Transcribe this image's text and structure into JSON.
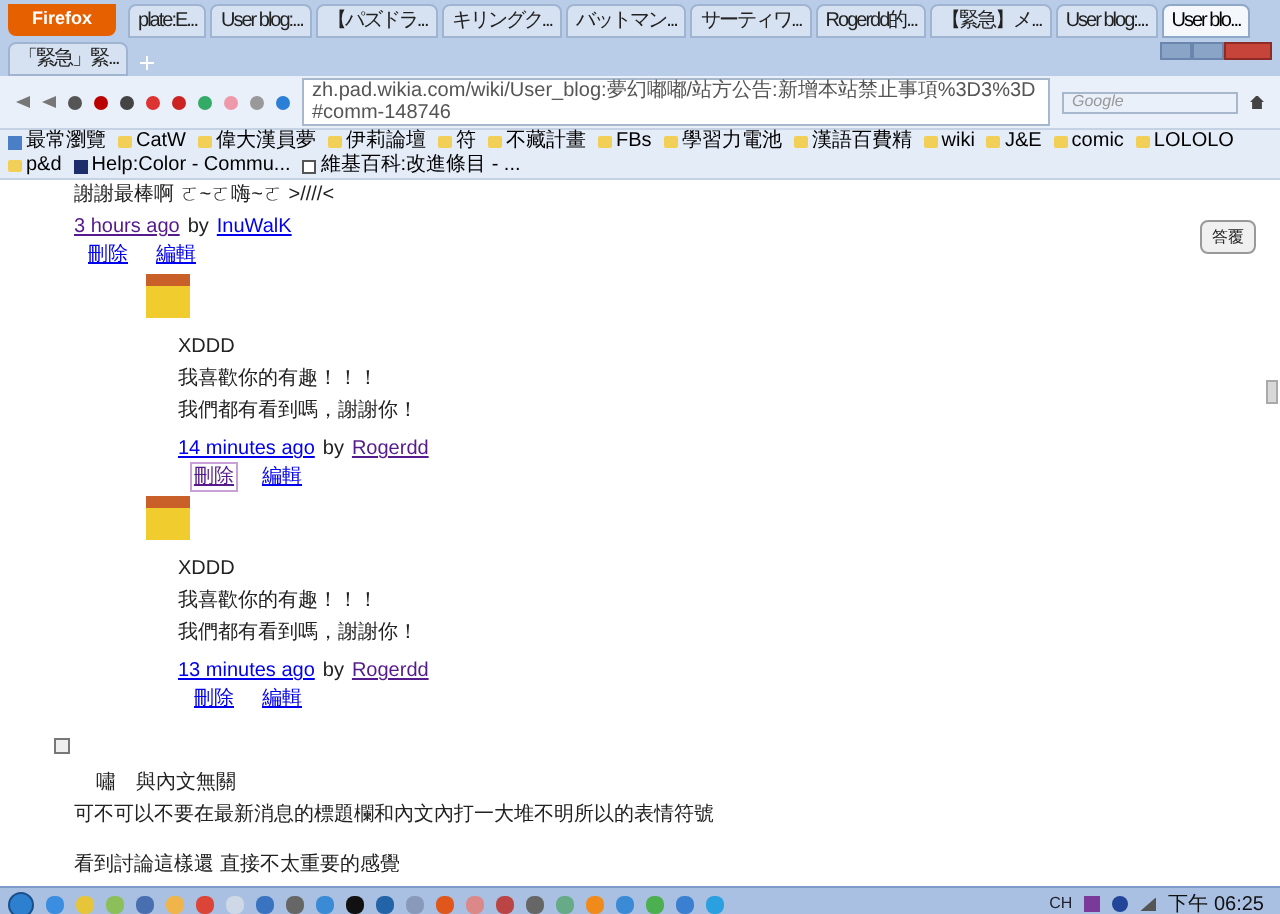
{
  "browser": {
    "menu_button": "Firefox",
    "tabs": [
      {
        "title": "plate:E...",
        "selected": false
      },
      {
        "title": "User blog:...",
        "selected": false
      },
      {
        "title": "【パズドラ...",
        "selected": false
      },
      {
        "title": "キリングク...",
        "selected": false
      },
      {
        "title": "バットマン...",
        "selected": false
      },
      {
        "title": "サーティワ...",
        "selected": false
      },
      {
        "title": "Rogerdd的...",
        "selected": false
      },
      {
        "title": "【緊急】メ...",
        "selected": false
      },
      {
        "title": "User blog:...",
        "selected": false
      },
      {
        "title": "User blo...",
        "selected": true
      },
      {
        "title": "「緊急」緊...",
        "selected": false
      }
    ],
    "url": "zh.pad.wikia.com/wiki/User_blog:夢幻嘟嘟/站方公告:新增本站禁止事項%3D3%3D#comm-148746",
    "search": {
      "placeholder": "Google"
    },
    "bookmarks": [
      {
        "label": "最常瀏覽",
        "kind": "special"
      },
      {
        "label": "CatW",
        "kind": "folder"
      },
      {
        "label": "偉大漢員夢",
        "kind": "folder"
      },
      {
        "label": "伊莉論壇",
        "kind": "folder"
      },
      {
        "label": "符",
        "kind": "folder"
      },
      {
        "label": "不藏計畫",
        "kind": "folder"
      },
      {
        "label": "FBs",
        "kind": "folder"
      },
      {
        "label": "學習力電池",
        "kind": "folder"
      },
      {
        "label": "漢語百費精",
        "kind": "folder"
      },
      {
        "label": "wiki",
        "kind": "folder"
      },
      {
        "label": "J&E",
        "kind": "folder"
      },
      {
        "label": "comic",
        "kind": "folder"
      },
      {
        "label": "LOLOLO",
        "kind": "folder"
      },
      {
        "label": "p&d",
        "kind": "folder"
      },
      {
        "label": "Help:Color - Commu...",
        "kind": "page"
      },
      {
        "label": "維基百科:改進條目 - ...",
        "kind": "wiki"
      }
    ]
  },
  "page": {
    "top_text": "謝謝最棒啊 ㄛ~ㄛ嗨~ㄛ >////<",
    "top_meta": {
      "time": "3 hours ago",
      "by": "by",
      "author": "InuWalK"
    },
    "top_actions": [
      {
        "label": "刪除",
        "hovered": false
      },
      {
        "label": "編輯",
        "hovered": false
      }
    ],
    "reply_button": "答覆",
    "replies": [
      {
        "lines": [
          "XDDD",
          "我喜歡你的有趣！！！",
          "我們都有看到嗎，謝謝你！"
        ],
        "time": "14 minutes ago",
        "by": "by",
        "author": "Rogerdd",
        "actions": [
          {
            "label": "刪除",
            "hovered": true
          },
          {
            "label": "編輯",
            "hovered": false
          }
        ]
      },
      {
        "lines": [
          "XDDD",
          "我喜歡你的有趣！！！",
          "我們都有看到嗎，謝謝你！"
        ],
        "time": "13 minutes ago",
        "by": "by",
        "author": "Rogerdd",
        "actions": [
          {
            "label": "刪除",
            "hovered": false
          },
          {
            "label": "編輯",
            "hovered": false
          }
        ]
      }
    ],
    "heading": "嘯　與內文無關",
    "body": "可不可以不要在最新消息的標題欄和內文內打一大堆不明所以的表情符號",
    "last_line": "看到討論這樣還 直接不太重要的感覺"
  },
  "taskbar": {
    "ime": "CH",
    "clock": "下午 06:25"
  }
}
